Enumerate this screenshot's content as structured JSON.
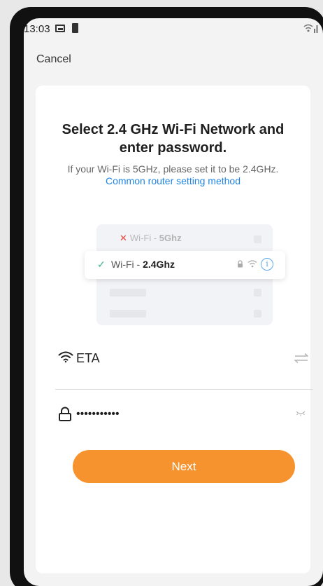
{
  "status": {
    "time": "13:03"
  },
  "header": {
    "cancel_label": "Cancel"
  },
  "main": {
    "title": "Select 2.4 GHz Wi-Fi Network and enter password.",
    "hint": "If your Wi-Fi is 5GHz, please set it to be 2.4GHz.",
    "link": "Common router setting method"
  },
  "illustration": {
    "row1_prefix": "Wi-Fi - ",
    "row1_band": "5Ghz",
    "row2_prefix": "Wi-Fi - ",
    "row2_band": "2.4Ghz"
  },
  "form": {
    "ssid_value": "ETA",
    "password_masked": "•••••••••••",
    "next_label": "Next"
  },
  "colors": {
    "accent": "#f7932f",
    "link": "#1e84e6",
    "check": "#3db38b",
    "error": "#e8443a"
  },
  "icons": [
    "image-icon",
    "battery-icon",
    "wifi-signal-icon",
    "wifi-icon",
    "switch-network-icon",
    "lock-icon",
    "eye-closed-icon",
    "info-icon",
    "check-icon",
    "cross-icon"
  ]
}
